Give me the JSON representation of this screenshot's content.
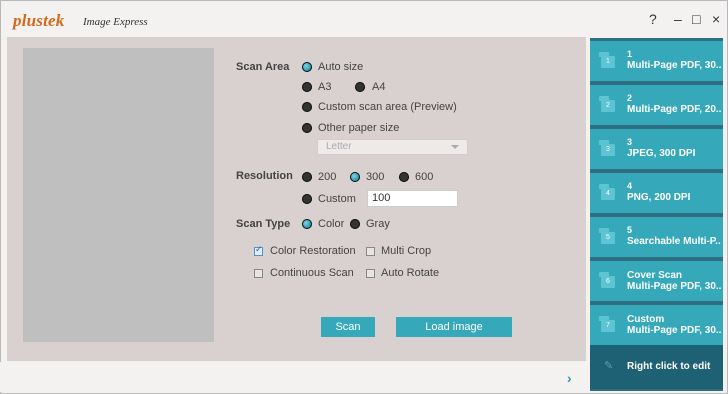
{
  "app": {
    "logo": "plustek",
    "title": "Image Express"
  },
  "window_controls": {
    "help": "?",
    "minimize": "–",
    "maximize": "□",
    "close": "×"
  },
  "scan_area": {
    "label": "Scan Area",
    "options": [
      "Auto size",
      "A3",
      "A4",
      "Custom scan area (Preview)",
      "Other paper size"
    ],
    "selected": "Auto size",
    "paper_size": {
      "value": "Letter"
    }
  },
  "resolution": {
    "label": "Resolution",
    "options": [
      "200",
      "300",
      "600"
    ],
    "selected": "300",
    "custom_label": "Custom",
    "custom_value": "100"
  },
  "scan_type": {
    "label": "Scan Type",
    "options": [
      "Color",
      "Gray"
    ],
    "selected": "Color"
  },
  "checkboxes": [
    {
      "label": "Color Restoration",
      "checked": true
    },
    {
      "label": "Multi Crop",
      "checked": false
    },
    {
      "label": "Continuous Scan",
      "checked": false
    },
    {
      "label": "Auto Rotate",
      "checked": false
    }
  ],
  "buttons": {
    "scan": "Scan",
    "load": "Load image"
  },
  "profiles": [
    {
      "badge": "1",
      "num": "1",
      "label": "Multi-Page PDF, 30..."
    },
    {
      "badge": "2",
      "num": "2",
      "label": "Multi-Page PDF, 20..."
    },
    {
      "badge": "3",
      "num": "3",
      "label": "JPEG, 300 DPI"
    },
    {
      "badge": "4",
      "num": "4",
      "label": "PNG, 200 DPI"
    },
    {
      "badge": "5",
      "num": "5",
      "label": "Searchable Multi-P..."
    },
    {
      "badge": "6",
      "name": "Cover Scan",
      "label": "Multi-Page PDF, 30..."
    },
    {
      "badge": "7",
      "name": "Custom",
      "label": "Multi-Page PDF, 30..."
    }
  ],
  "edit_hint": "Right click to edit",
  "colors": {
    "accent": "#35a8b9",
    "panel": "#2e6e80",
    "logo": "#d2691e"
  }
}
